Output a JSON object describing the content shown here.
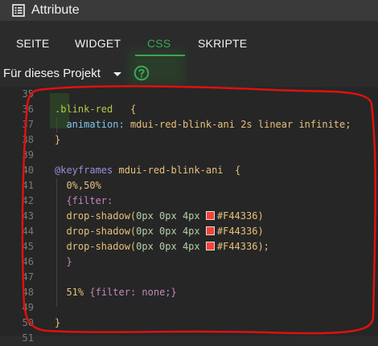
{
  "window": {
    "title": "Attribute",
    "icon": "list-icon"
  },
  "tabs": [
    {
      "label": "SEITE",
      "active": false
    },
    {
      "label": "WIDGET",
      "active": false
    },
    {
      "label": "CSS",
      "active": true
    },
    {
      "label": "SKRIPTE",
      "active": false
    }
  ],
  "scope": {
    "selected": "Für dieses Projekt",
    "help_icon": "question-circle-icon"
  },
  "colors": {
    "accent": "#3aa655",
    "annotation": "#e01010",
    "swatch": "#F44336"
  },
  "code": {
    "l35": "35",
    "l36": "36",
    "l37": "37",
    "l38": "38",
    "l39": "39",
    "l40": "40",
    "l41": "41",
    "l42": "42",
    "l43": "43",
    "l44": "44",
    "l45": "45",
    "l46": "46",
    "l47": "47",
    "l48": "48",
    "l49": "49",
    "l50": "50",
    "l51": "51",
    "blink_sel": ".blink-red",
    "brace_open": "{",
    "brace_close": "}",
    "prop_anim": "animation:",
    "val_anim": "mdui-red-blink-ani 2s linear infinite;",
    "keyframes_kw": "@keyframes",
    "keyframes_name": "mdui-red-blink-ani",
    "pct1": "0%,50%",
    "filter_open": "{filter:",
    "drop_fn": "drop-shadow(",
    "drop_args": "0px 0px 4px",
    "hex": "#F44336",
    "close_paren": ")",
    "close_paren_semi": ");",
    "pct2": "51%",
    "filter_none": "{filter: none;}"
  }
}
